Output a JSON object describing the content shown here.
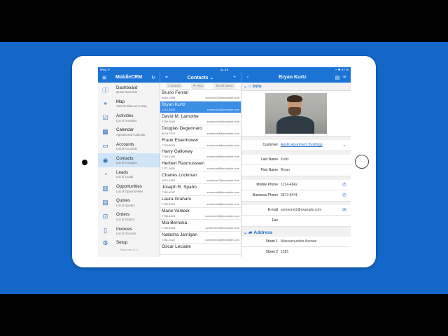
{
  "status": {
    "left": "iPad ᯤ",
    "time": "21:19",
    "right": "⌁ ✱ 47 %"
  },
  "nav": {
    "app_title": "MobileCRM",
    "list_title": "Contacts ⌄",
    "detail_title": "Bryan Kurtz"
  },
  "sidebar": {
    "items": [
      {
        "title": "Dashboard",
        "sub": "Quick Overview",
        "icon": "info-icon"
      },
      {
        "title": "Map",
        "sub": "View Entities on a Map",
        "icon": "map-pin-icon"
      },
      {
        "title": "Activities",
        "sub": "List of Activities",
        "icon": "activities-icon"
      },
      {
        "title": "Calendar",
        "sub": "Agenda and Calendar",
        "icon": "calendar-icon"
      },
      {
        "title": "Accounts",
        "sub": "List of Accounts",
        "icon": "folder-icon"
      },
      {
        "title": "Contacts",
        "sub": "List of Contacts",
        "icon": "contact-icon"
      },
      {
        "title": "Leads",
        "sub": "List of Leads",
        "icon": "leads-icon"
      },
      {
        "title": "Opportunities",
        "sub": "List of Opportunities",
        "icon": "chart-icon"
      },
      {
        "title": "Quotes",
        "sub": "List of Quotes",
        "icon": "quote-icon"
      },
      {
        "title": "Orders",
        "sub": "List of Orders",
        "icon": "cart-icon"
      },
      {
        "title": "Invoices",
        "sub": "List of Invoices",
        "icon": "invoice-icon"
      },
      {
        "title": "Setup",
        "sub": "",
        "icon": "gear-icon"
      }
    ],
    "footer": "Resco.net 11.0"
  },
  "toolbar": {
    "search": "Search",
    "filter": "Filter",
    "full_name": "Full Name"
  },
  "contacts": [
    {
      "name": "Bruno Ferrari",
      "phone": "8569-7896",
      "email": "someone12@example.com"
    },
    {
      "name": "Bryan Kurtz",
      "phone": "1214-4842",
      "email": "someone1@example.com"
    },
    {
      "name": "David M. Lamothe",
      "phone": "4789-0545",
      "email": "someone2@example.com"
    },
    {
      "name": "Douglas Degennaro",
      "phone": "8509-7874",
      "email": "someone3@example.com"
    },
    {
      "name": "Frank Eisenhower",
      "phone": "7730-8643",
      "email": "someone4@example.com"
    },
    {
      "name": "Harry Galloway",
      "phone": "7790-4389",
      "email": "someone5@example.com"
    },
    {
      "name": "Herbert Rasmusssen",
      "phone": "7777-3636",
      "email": "someone6@example.com"
    },
    {
      "name": "Charles Lockman",
      "phone": "4022-4506",
      "email": "someone7@example.com"
    },
    {
      "name": "Joseph R. Spahn",
      "phone": "7762-8787",
      "email": "someone8@example.com"
    },
    {
      "name": "Laura Graham",
      "phone": "7730-5222",
      "email": "someone9@example.com"
    },
    {
      "name": "Marie Vanleer",
      "phone": "7796-4126",
      "email": "someone10@example.com"
    },
    {
      "name": "Mia Bernska",
      "phone": "7736-8433",
      "email": "someone11@example.com"
    },
    {
      "name": "Natasha Jarnigan",
      "phone": "7781-5122",
      "email": "someone13@example.com"
    },
    {
      "name": "Oscar Leclaire",
      "phone": "",
      "email": ""
    }
  ],
  "detail": {
    "info_label": "Info",
    "customer": {
      "label": "Customer",
      "value": "Apollo Apartment Buildings"
    },
    "last_name": {
      "label": "Last Name",
      "value": "Kurtz"
    },
    "first_name": {
      "label": "First Name",
      "value": "Bryan"
    },
    "mobile": {
      "label": "Mobile Phone",
      "value": "1214-4842"
    },
    "business": {
      "label": "Business Phone",
      "value": "3573-8441"
    },
    "email": {
      "label": "E-mail",
      "value": "someone1@example.com"
    },
    "fax": {
      "label": "Fax",
      "value": ""
    },
    "address_label": "Address",
    "street1": {
      "label": "Street 1",
      "value": "Massachusetts Avenue"
    },
    "street2": {
      "label": "Street 2",
      "value": "1285"
    }
  },
  "colors": {
    "accent": "#1b73d6",
    "background": "#1466c8",
    "selected_row": "#3a8ee6"
  }
}
